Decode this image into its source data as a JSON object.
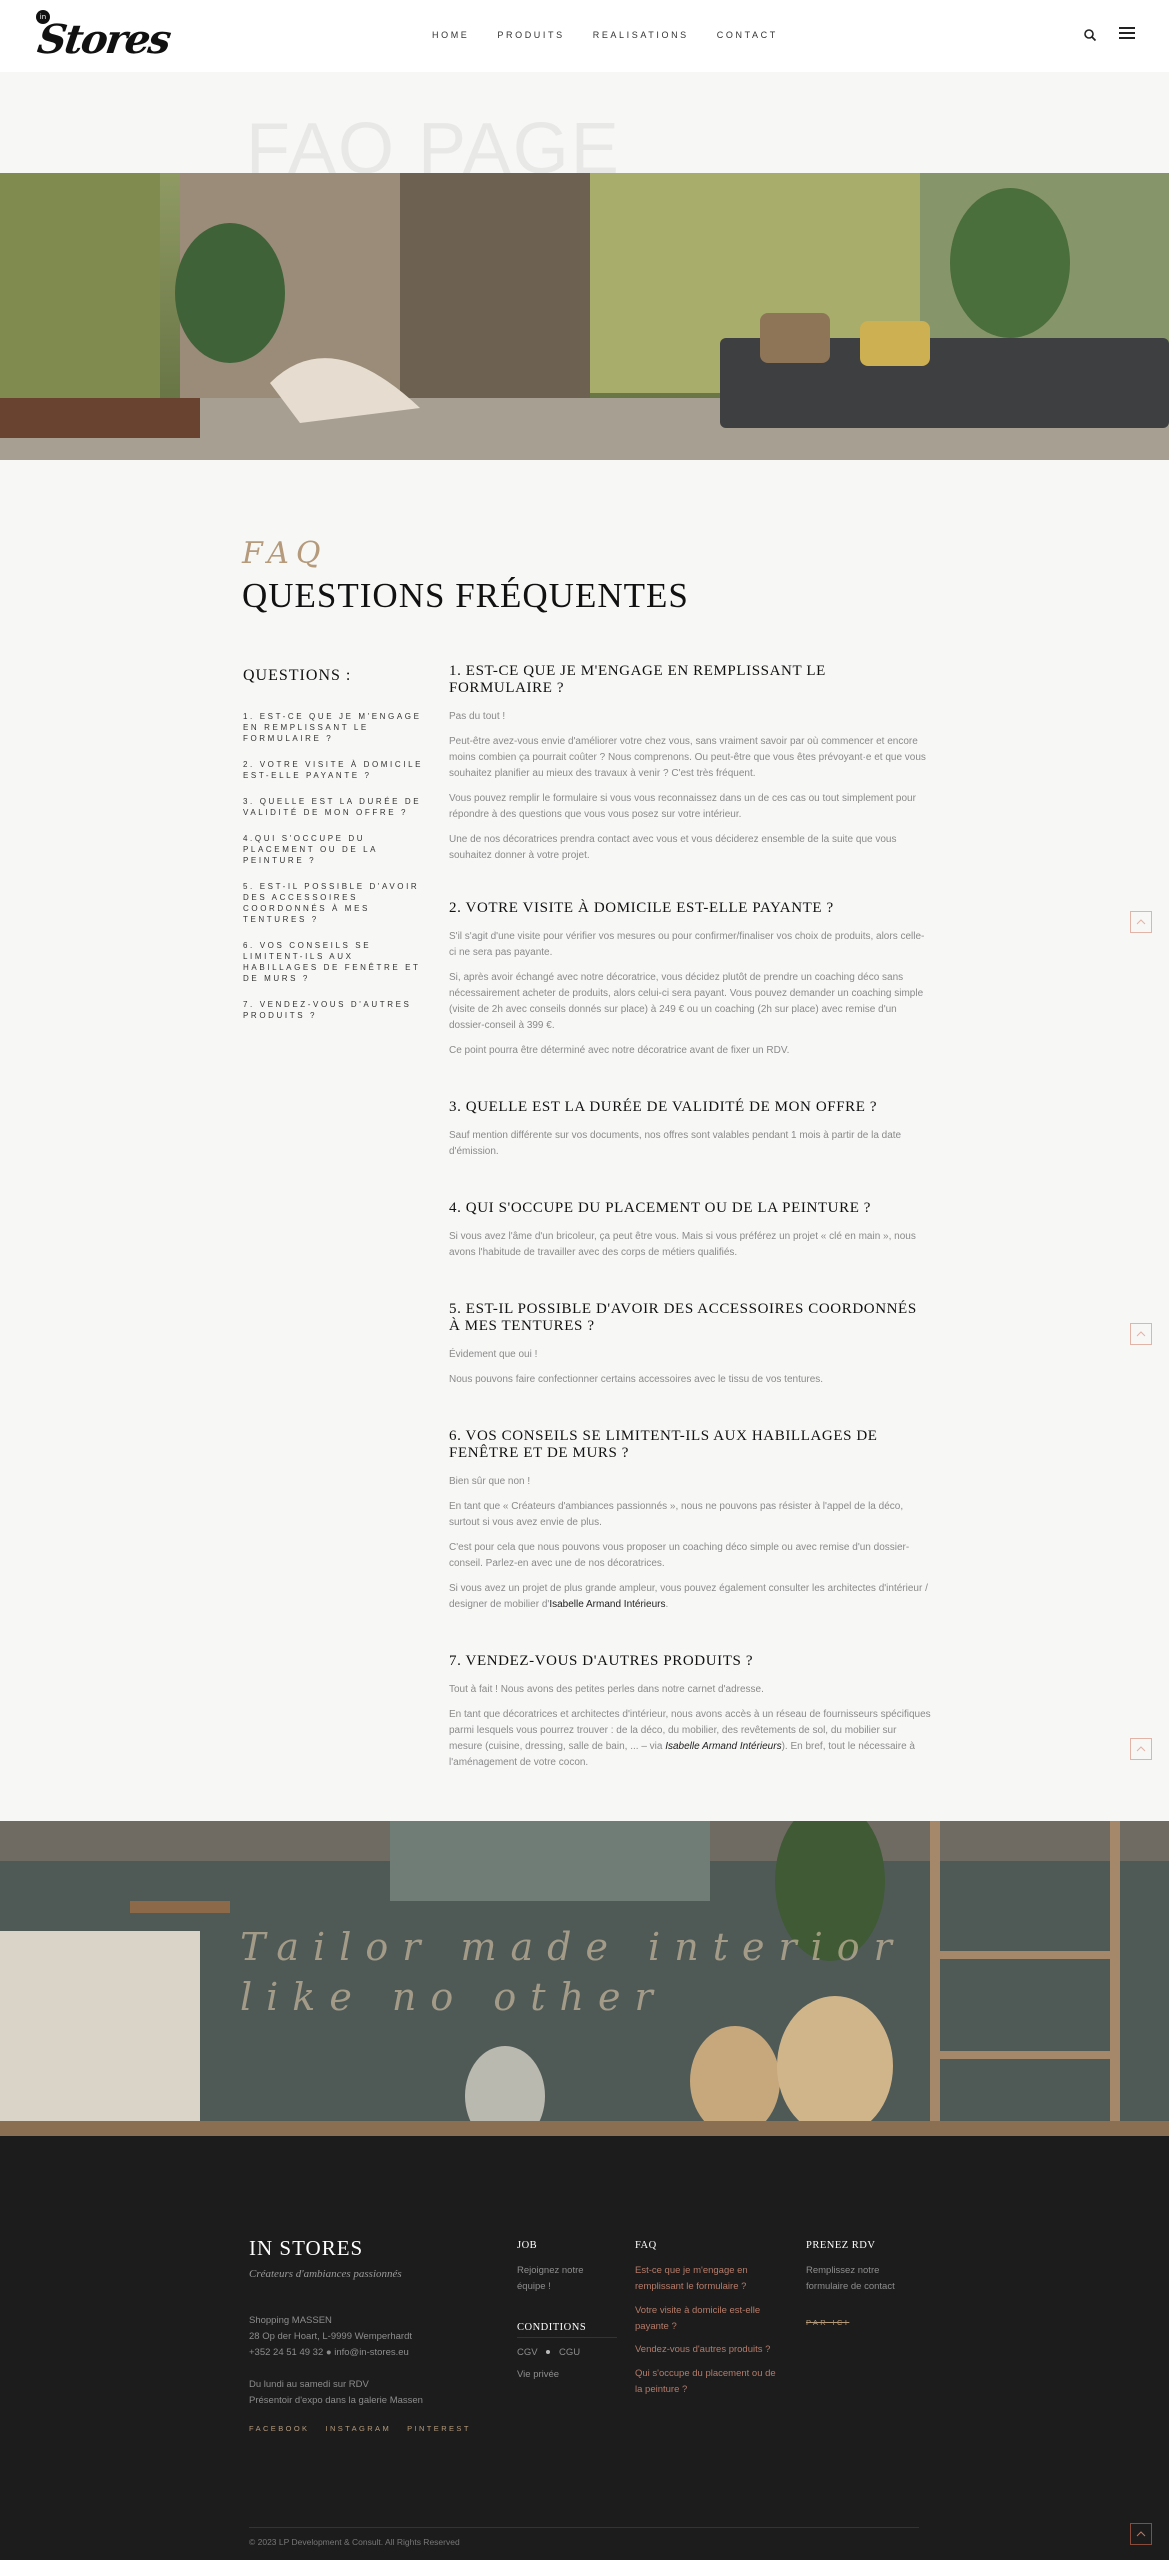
{
  "header": {
    "logo_badge": "in",
    "logo_word": "Stores",
    "nav": [
      "HOME",
      "PRODUITS",
      "REALISATIONS",
      "CONTACT"
    ]
  },
  "hero": {
    "background_title": "FAQ PAGE"
  },
  "faq": {
    "kicker": "FAQ",
    "title": "QUESTIONS FRÉQUENTES",
    "toc_title": "QUESTIONS :",
    "toc": [
      "1. EST-CE QUE JE M'ENGAGE EN REMPLISSANT LE FORMULAIRE ?",
      "2. VOTRE VISITE À DOMICILE EST-ELLE PAYANTE ?",
      "3. QUELLE EST LA DURÉE DE VALIDITÉ DE MON OFFRE ?",
      "4.QUI S'OCCUPE DU PLACEMENT OU DE LA PEINTURE ?",
      "5. EST-IL POSSIBLE D'AVOIR DES ACCESSOIRES COORDONNÉS À MES TENTURES ?",
      "6. VOS CONSEILS SE LIMITENT-ILS AUX HABILLAGES DE FENÊTRE ET DE MURS ?",
      "7. VENDEZ-VOUS D'AUTRES PRODUITS ?"
    ],
    "q1": {
      "title": "1. EST-CE QUE JE M'ENGAGE EN REMPLISSANT LE FORMULAIRE ?",
      "p1": "Pas du tout !",
      "p2": "Peut-être avez-vous envie d'améliorer votre chez vous, sans vraiment savoir par où commencer et encore moins combien ça pourrait coûter ? Nous comprenons. Ou peut-être que vous êtes prévoyant·e et que vous souhaitez planifier au mieux des travaux à venir ? C'est très fréquent.",
      "p3": "Vous pouvez remplir le formulaire si vous vous reconnaissez dans un de ces cas ou tout simplement pour répondre à des questions que vous vous posez sur votre intérieur.",
      "p4": "Une de nos décoratrices prendra contact avec vous et vous déciderez ensemble de la suite que vous souhaitez donner à votre projet."
    },
    "q2": {
      "title": "2. VOTRE VISITE À DOMICILE EST-ELLE PAYANTE ?",
      "p1": "S'il s'agit d'une visite pour vérifier vos mesures ou pour confirmer/finaliser vos choix de produits, alors celle-ci ne sera pas payante.",
      "p2": "Si, après avoir échangé avec notre décoratrice, vous décidez plutôt de prendre un coaching déco sans nécessairement acheter de produits, alors celui-ci sera payant. Vous pouvez demander un coaching simple (visite de 2h avec conseils donnés sur place) à 249 € ou un coaching (2h sur place) avec remise d'un dossier-conseil à 399 €.",
      "p3": "Ce point pourra être déterminé avec notre décoratrice avant de fixer un RDV."
    },
    "q3": {
      "title": "3. QUELLE EST LA DURÉE DE VALIDITÉ DE MON OFFRE ?",
      "p1": "Sauf mention différente sur vos documents, nos offres sont valables pendant 1 mois à partir de la date d'émission."
    },
    "q4": {
      "title": "4. QUI S'OCCUPE DU PLACEMENT OU DE LA PEINTURE ?",
      "p1": "Si vous avez l'âme d'un bricoleur, ça peut être vous. Mais si vous préférez un projet « clé en main », nous avons l'habitude de travailler avec des corps de métiers qualifiés."
    },
    "q5": {
      "title": "5. EST-IL POSSIBLE D'AVOIR DES ACCESSOIRES COORDONNÉS À MES TENTURES ?",
      "p1": "Évidement que oui !",
      "p2": "Nous pouvons faire confectionner certains accessoires avec le tissu de vos tentures."
    },
    "q6": {
      "title": "6. VOS CONSEILS SE LIMITENT-ILS AUX HABILLAGES DE FENÊTRE ET DE MURS ?",
      "p1": "Bien sûr que non !",
      "p2": "En tant que « Créateurs d'ambiances passionnés », nous ne pouvons pas résister à l'appel de la déco, surtout si vous avez envie de plus.",
      "p3": "C'est pour cela que nous pouvons vous proposer un coaching déco simple ou avec remise d'un dossier-conseil. Parlez-en avec une de nos décoratrices.",
      "p4_pre": "Si vous avez un projet de plus grande ampleur, vous pouvez également consulter les architectes d'intérieur / designer de mobilier d'",
      "p4_link": "Isabelle Armand Intérieurs",
      "p4_post": "."
    },
    "q7": {
      "title": "7. VENDEZ-VOUS D'AUTRES PRODUITS ?",
      "p1": "Tout à fait ! Nous avons des petites perles dans notre carnet d'adresse.",
      "p2_pre": "En tant que décoratrices et architectes d'intérieur, nous avons accès à un réseau de fournisseurs spécifiques parmi lesquels vous pourrez trouver : de la déco, du mobilier, des revêtements de sol, du mobilier sur mesure (cuisine, dressing, salle de bain, ... – via ",
      "p2_link": "Isabelle Armand Intérieurs",
      "p2_post": "). En bref, tout le nécessaire à l'aménagement de votre cocon."
    }
  },
  "banner": {
    "line1": "Tailor made interior",
    "line2": "like no other"
  },
  "footer": {
    "brand": "IN STORES",
    "tagline": "Créateurs d'ambiances passionnés",
    "address1": "Shopping MASSEN",
    "address2": "28 Op der Hoart, L-9999 Wemperhardt",
    "contact": "+352 24 51 49 32 ● info@in-stores.eu",
    "hours1": "Du lundi au samedi sur RDV",
    "hours2": "Présentoir d'expo dans la galerie Massen",
    "social": [
      "FACEBOOK",
      "INSTAGRAM",
      "PINTEREST"
    ],
    "job_title": "JOB",
    "job_link": "Rejoignez notre équipe !",
    "conditions_title": "CONDITIONS",
    "cgv": "CGV",
    "cgu": "CGU",
    "privacy": "Vie privée",
    "faq_title": "FAQ",
    "faq_links": [
      "Est-ce que je m'engage en remplissant le formulaire ?",
      "Votre visite à domicile est-elle payante ?",
      "Vendez-vous d'autres produits ?",
      "Qui s'occupe du placement ou de la peinture ?"
    ],
    "rdv_title": "PRENEZ RDV",
    "rdv_text": "Remplissez notre formulaire de contact",
    "rdv_link": "PAR ICI",
    "copyright": "© 2023 LP Development & Consult. All Rights Reserved"
  },
  "colors": {
    "accent_gold": "#b59a7b",
    "accent_rust": "#b57b6a",
    "footer_bg": "#1c1c1c",
    "page_bg": "#f7f7f6"
  },
  "icons": [
    "search-icon",
    "menu-icon",
    "arrow-up-icon"
  ]
}
